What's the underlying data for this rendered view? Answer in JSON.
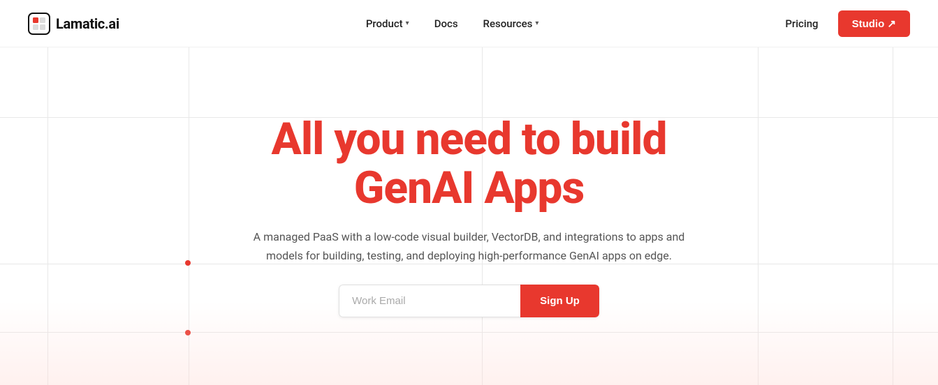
{
  "brand": {
    "logo_text": "Lamatic.ai",
    "logo_icon": "square-icon"
  },
  "navbar": {
    "links": [
      {
        "label": "Product",
        "has_dropdown": true
      },
      {
        "label": "Docs",
        "has_dropdown": false
      },
      {
        "label": "Resources",
        "has_dropdown": true
      }
    ],
    "pricing_label": "Pricing",
    "studio_label": "Studio ↗"
  },
  "hero": {
    "title_line1": "All you need to build",
    "title_line2": "GenAI Apps",
    "subtitle": "A managed PaaS with a low-code visual builder, VectorDB, and integrations to apps and models for building, testing, and deploying high-performance GenAI apps on edge.",
    "email_placeholder": "Work Email",
    "signup_label": "Sign Up"
  },
  "colors": {
    "accent": "#e8382e",
    "text_dark": "#111",
    "text_mid": "#555",
    "grid_line": "#e8e8e8"
  }
}
